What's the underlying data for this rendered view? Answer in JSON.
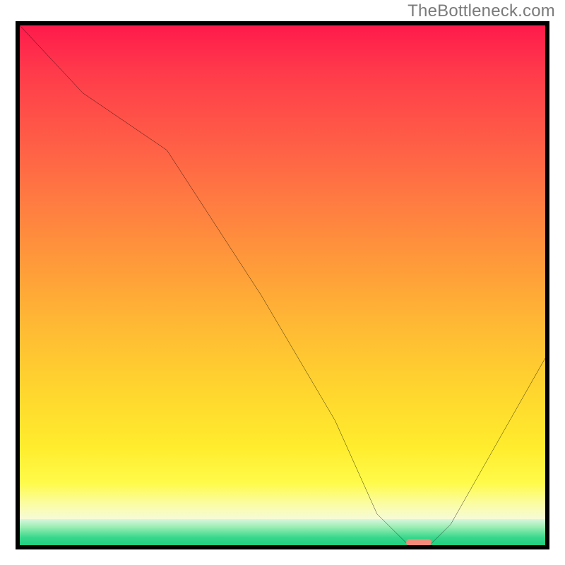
{
  "watermark": "TheBottleneck.com",
  "chart_data": {
    "type": "line",
    "title": "",
    "xlabel": "",
    "ylabel": "",
    "xlim": [
      0,
      100
    ],
    "ylim": [
      0,
      100
    ],
    "grid": false,
    "series": [
      {
        "name": "bottleneck-curve",
        "x": [
          0,
          12,
          28,
          46,
          60,
          68,
          74,
          78,
          82,
          100
        ],
        "values": [
          100,
          87,
          76,
          48,
          24,
          6,
          0,
          0,
          4,
          36
        ]
      }
    ],
    "annotations": [
      {
        "name": "optimal-marker",
        "x": 76,
        "y": 0.5
      }
    ],
    "background_gradient": {
      "stops": [
        {
          "pct": 0,
          "color": "#ff1a4b"
        },
        {
          "pct": 50,
          "color": "#ff9a3a"
        },
        {
          "pct": 88,
          "color": "#fffb4a"
        },
        {
          "pct": 95,
          "color": "#f6fbd8"
        },
        {
          "pct": 100,
          "color": "#1fcf80"
        }
      ]
    }
  }
}
